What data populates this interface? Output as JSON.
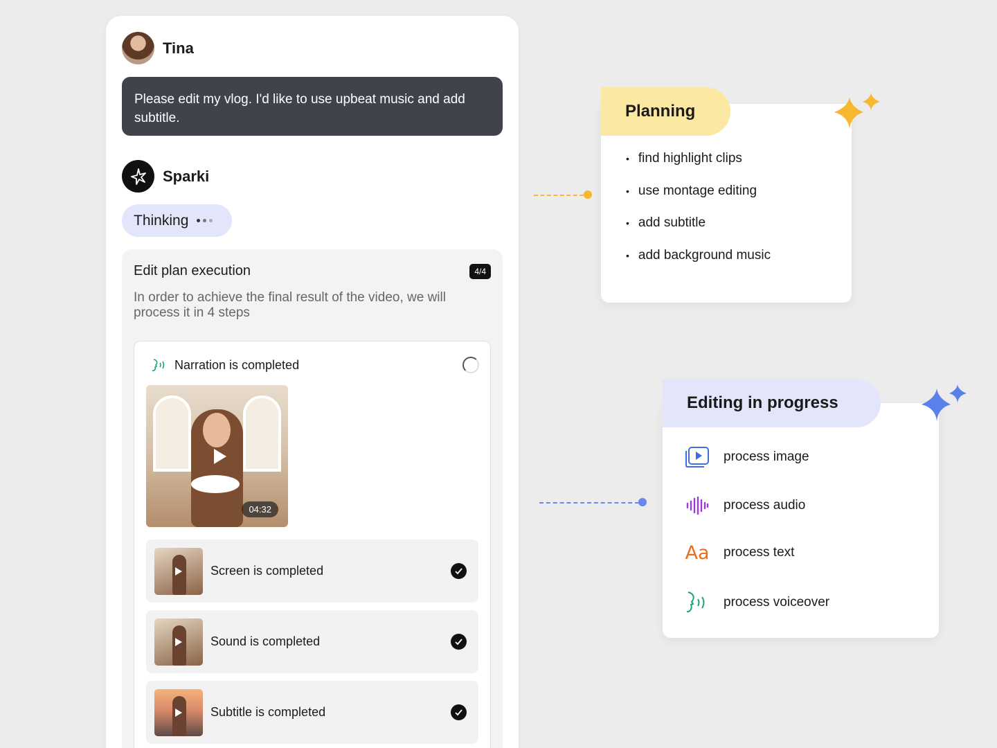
{
  "user": {
    "name": "Tina",
    "message": "Please edit my vlog. I'd like to use upbeat music and add subtitle."
  },
  "bot": {
    "name": "Sparki",
    "status": "Thinking"
  },
  "plan": {
    "title": "Edit plan execution",
    "badge": "4/4",
    "description": "In order to achieve the final result of the video, we will process it in 4 steps",
    "narration_label": "Narration is completed",
    "video_duration": "04:32",
    "steps": [
      {
        "label": "Screen is completed"
      },
      {
        "label": "Sound is completed"
      },
      {
        "label": "Subtitle is completed"
      }
    ]
  },
  "planning": {
    "title": "Planning",
    "items": [
      "find highlight clips",
      "use montage editing",
      "add subtitle",
      "add background music"
    ]
  },
  "editing": {
    "title": "Editing in progress",
    "items": [
      {
        "label": "process image",
        "icon": "video-frame-icon"
      },
      {
        "label": "process audio",
        "icon": "audio-wave-icon"
      },
      {
        "label": "process text",
        "icon": "text-aa-icon",
        "glyph": "Aa"
      },
      {
        "label": "process voiceover",
        "icon": "voice-icon"
      }
    ]
  },
  "colors": {
    "planning_accent": "#f7b731",
    "editing_accent": "#6b85ea",
    "audio_icon": "#9b3bd8",
    "voice_icon": "#19a37a",
    "text_icon": "#f06a1c"
  }
}
